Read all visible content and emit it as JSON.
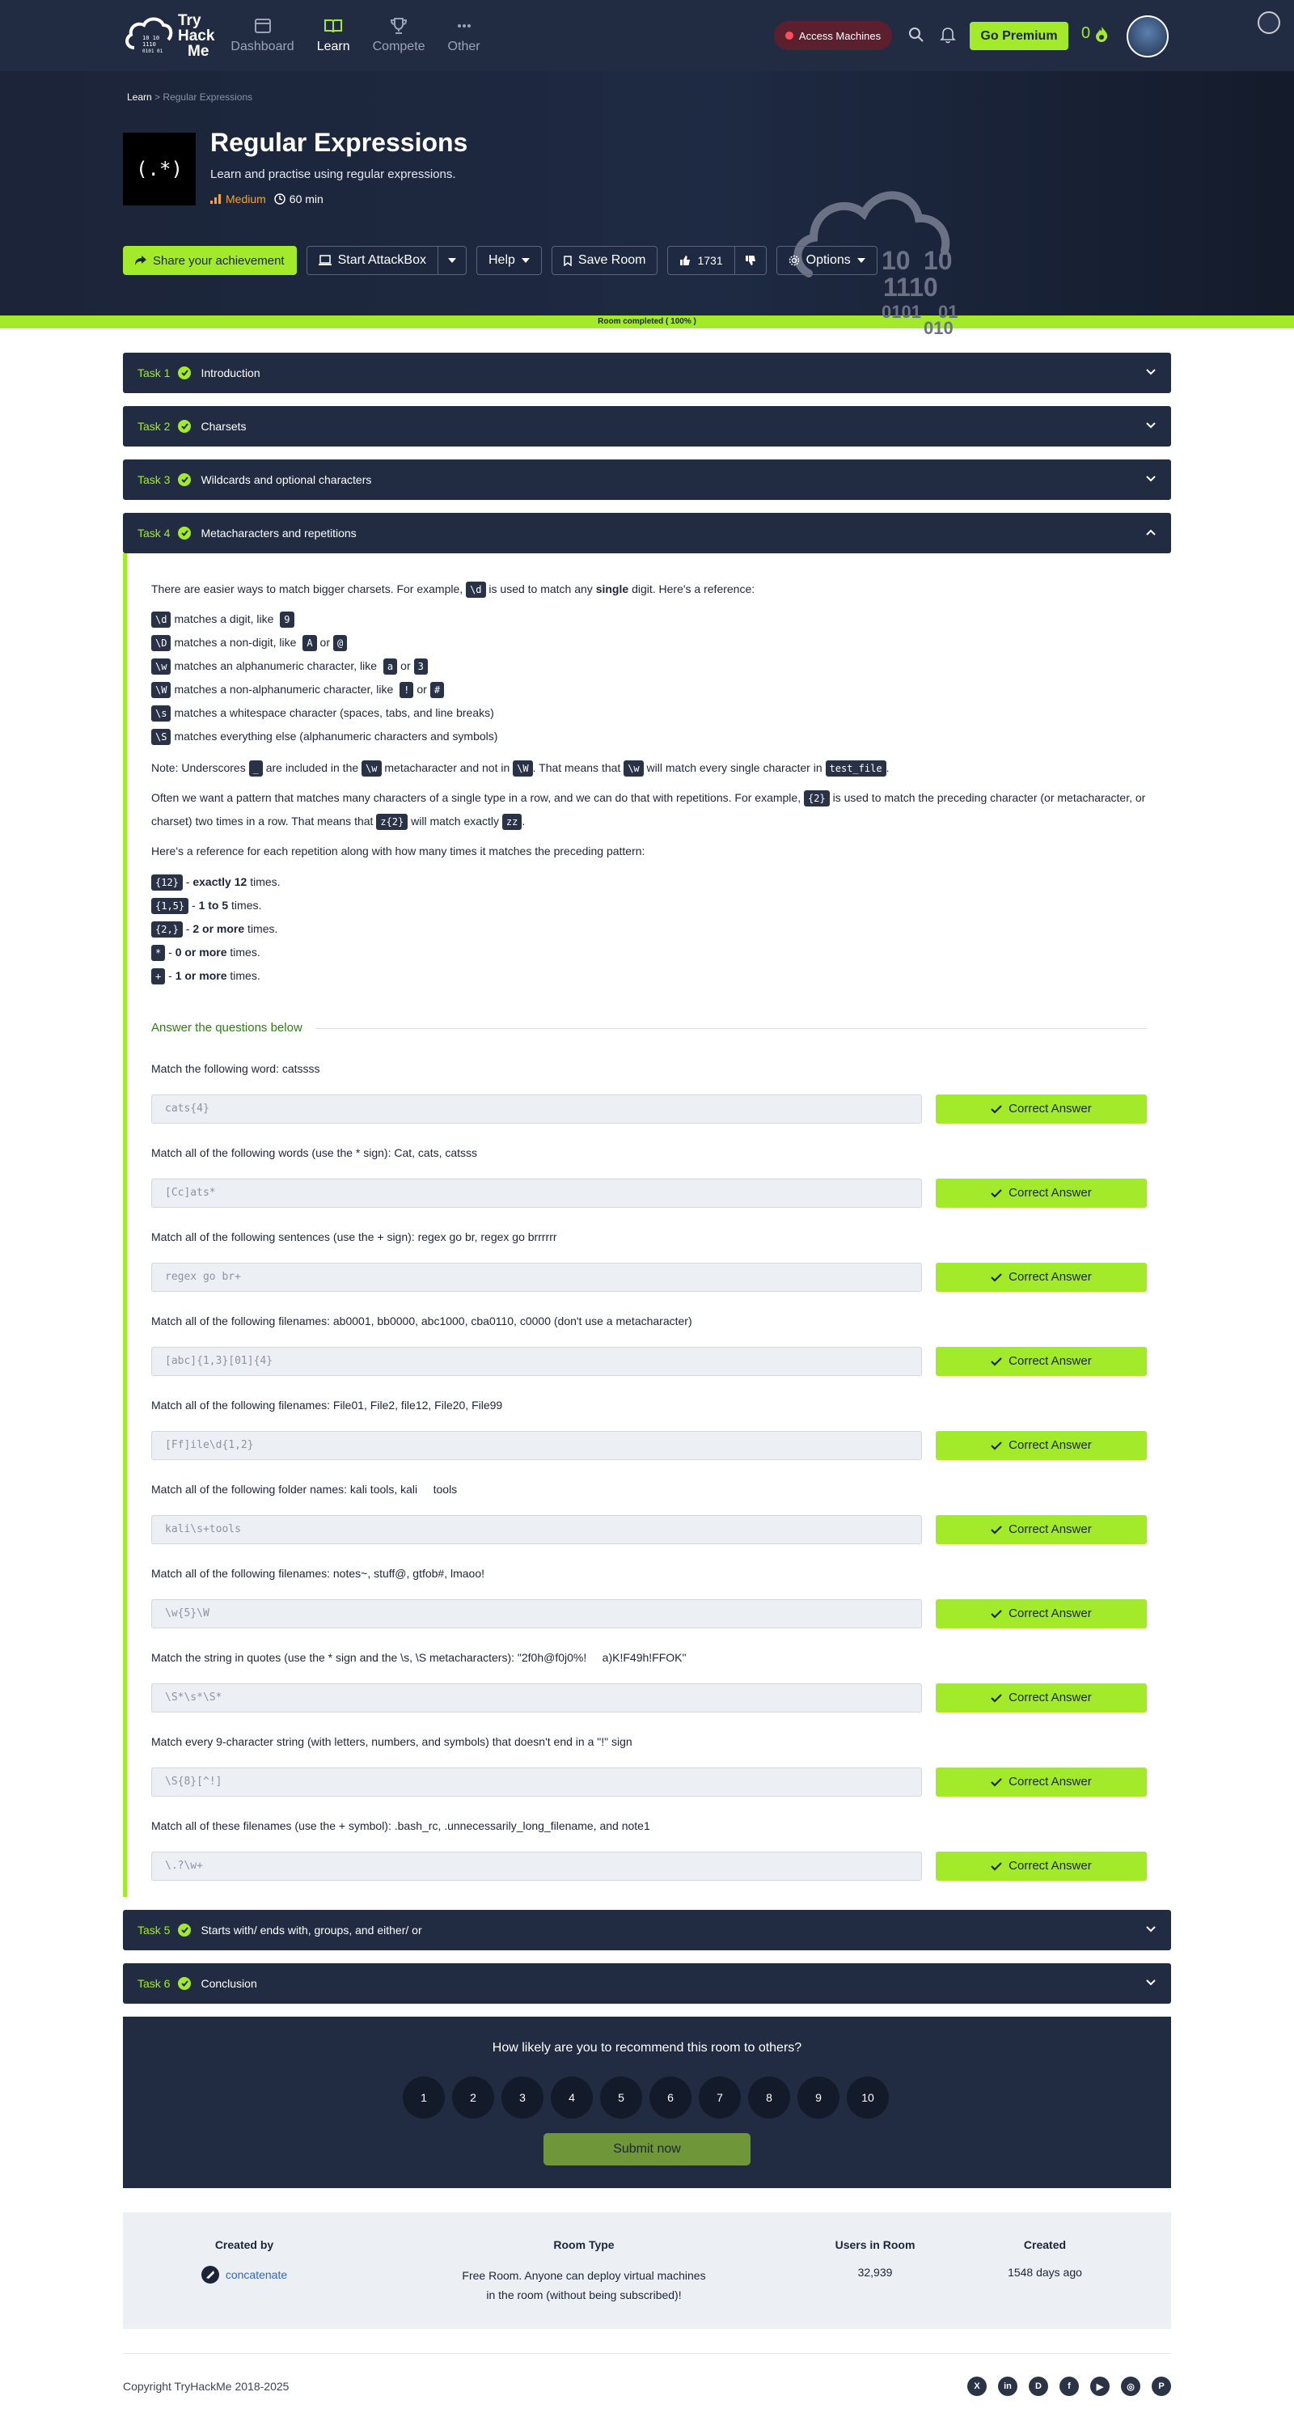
{
  "nav": {
    "logo_lines": [
      "Try",
      "Hack",
      "Me"
    ],
    "items": [
      {
        "label": "Dashboard"
      },
      {
        "label": "Learn"
      },
      {
        "label": "Compete"
      },
      {
        "label": "Other"
      }
    ],
    "access_machines": "Access Machines",
    "go_premium": "Go Premium",
    "streak": "0"
  },
  "hero": {
    "breadcrumb": {
      "root": "Learn",
      "sep": ">",
      "current": "Regular Expressions"
    },
    "icon_text": "(.*)",
    "title": "Regular Expressions",
    "description": "Learn and practise using regular expressions.",
    "difficulty": "Medium",
    "duration": "60 min",
    "buttons": {
      "share": "Share your achievement",
      "attackbox": "Start AttackBox",
      "help": "Help",
      "save": "Save Room",
      "likes": "1731",
      "options": "Options"
    },
    "art_digits": [
      "10",
      "10",
      "1110",
      "0101",
      "01",
      "010"
    ]
  },
  "progress_text": "Room completed ( 100% )",
  "tasks": [
    {
      "num": "Task 1",
      "title": "Introduction"
    },
    {
      "num": "Task 2",
      "title": "Charsets"
    },
    {
      "num": "Task 3",
      "title": "Wildcards and optional characters"
    },
    {
      "num": "Task 4",
      "title": "Metacharacters and repetitions"
    },
    {
      "num": "Task 5",
      "title": "Starts with/ ends with, groups, and either/ or"
    },
    {
      "num": "Task 6",
      "title": "Conclusion"
    }
  ],
  "task4": {
    "intro_a": "There are easier ways to match bigger charsets. For example,",
    "intro_code": "\\d",
    "intro_b": "is used to match any",
    "intro_bold": "single",
    "intro_c": "digit. Here's a reference:",
    "refs": [
      {
        "code": "\\d",
        "text_a": "matches a digit, like",
        "ex1": "9",
        "mid": "",
        "ex2": "",
        "tail": ""
      },
      {
        "code": "\\D",
        "text_a": "matches a non-digit, like",
        "ex1": "A",
        "mid": "or",
        "ex2": "@",
        "tail": ""
      },
      {
        "code": "\\w",
        "text_a": "matches an alphanumeric character, like",
        "ex1": "a",
        "mid": "or",
        "ex2": "3",
        "tail": ""
      },
      {
        "code": "\\W",
        "text_a": "matches a non-alphanumeric character, like",
        "ex1": "!",
        "mid": "or",
        "ex2": "#",
        "tail": ""
      },
      {
        "code": "\\s",
        "text_a": "matches a whitespace character (spaces, tabs, and line breaks)",
        "ex1": "",
        "mid": "",
        "ex2": "",
        "tail": ""
      },
      {
        "code": "\\S",
        "text_a": "matches everything else (alphanumeric characters and symbols)",
        "ex1": "",
        "mid": "",
        "ex2": "",
        "tail": ""
      }
    ],
    "note_a": "Note: Underscores",
    "note_code1": "_",
    "note_b": "are included in the",
    "note_code2": "\\w",
    "note_c": "metacharacter and not in",
    "note_code3": "\\W",
    "note_d": ". That means that",
    "note_code4": "\\w",
    "note_e": "will match every single character in",
    "note_code5": "test_file",
    "note_f": ".",
    "rep_a": "Often we want a pattern that matches many characters of a single type in a row, and we can do that with repetitions. For example,",
    "rep_code1": "{2}",
    "rep_b": "is used to match the preceding character (or metacharacter, or charset) two times in a row. That means that",
    "rep_code2": "z{2}",
    "rep_c": "will match exactly",
    "rep_code3": "zz",
    "rep_d": ".",
    "rep_ref": "Here's a reference for each repetition along with how many times it matches the preceding pattern:",
    "reps": [
      {
        "code": "{12}",
        "dash": " - ",
        "bold": "exactly 12",
        "tail": " times."
      },
      {
        "code": "{1,5}",
        "dash": " - ",
        "bold": "1 to 5",
        "tail": " times."
      },
      {
        "code": "{2,}",
        "dash": " - ",
        "bold": "2 or more",
        "tail": " times."
      },
      {
        "code": "*",
        "dash": " - ",
        "bold": "0 or more",
        "tail": " times."
      },
      {
        "code": "+",
        "dash": " - ",
        "bold": "1 or more",
        "tail": " times."
      }
    ],
    "answers_title": "Answer the questions below",
    "correct_label": "Correct Answer",
    "questions": [
      {
        "q": "Match the following word: catssss",
        "a": "cats{4}"
      },
      {
        "q": "Match all of the following words (use the * sign): Cat, cats, catsss",
        "a": "[Cc]ats*"
      },
      {
        "q": "Match all of the following sentences (use the + sign): regex go br, regex go brrrrrr",
        "a": "regex go br+"
      },
      {
        "q": "Match all of the following filenames: ab0001, bb0000, abc1000, cba0110, c0000 (don't use a metacharacter)",
        "a": "[abc]{1,3}[01]{4}"
      },
      {
        "q": "Match all of the following filenames: File01, File2, file12, File20, File99",
        "a": "[Ff]ile\\d{1,2}"
      },
      {
        "q": "Match all of the following folder names: kali tools, kali     tools",
        "a": "kali\\s+tools"
      },
      {
        "q": "Match all of the following filenames: notes~, stuff@, gtfob#, lmaoo!",
        "a": "\\w{5}\\W"
      },
      {
        "q": "Match the string in quotes (use the * sign and the \\s, \\S metacharacters): \"2f0h@f0j0%!     a)K!F49h!FFOK\"",
        "a": "\\S*\\s*\\S*"
      },
      {
        "q": "Match every 9-character string (with letters, numbers, and symbols) that doesn't end in a \"!\" sign",
        "a": "\\S{8}[^!]"
      },
      {
        "q": "Match all of these filenames (use the + symbol): .bash_rc, .unnecessarily_long_filename, and note1",
        "a": "\\.?\\w+"
      }
    ]
  },
  "rating": {
    "question": "How likely are you to recommend this room to others?",
    "options": [
      "1",
      "2",
      "3",
      "4",
      "5",
      "6",
      "7",
      "8",
      "9",
      "10"
    ],
    "submit": "Submit now"
  },
  "info": {
    "created_by_h": "Created by",
    "creator": "concatenate",
    "room_type_h": "Room Type",
    "room_type_1": "Free Room. Anyone can deploy virtual machines",
    "room_type_2": "in the room (without being subscribed)!",
    "users_h": "Users in Room",
    "users": "32,939",
    "created_h": "Created",
    "created": "1548 days ago"
  },
  "footer": {
    "copyright": "Copyright TryHackMe 2018-2025",
    "socials": [
      "x-icon",
      "linkedin-icon",
      "discord-icon",
      "facebook-icon",
      "youtube-icon",
      "instagram-icon",
      "pinterest-icon"
    ]
  },
  "colors": {
    "accent": "#a3ea2a",
    "navy": "#212c42",
    "difficulty": "#f3a33b"
  }
}
